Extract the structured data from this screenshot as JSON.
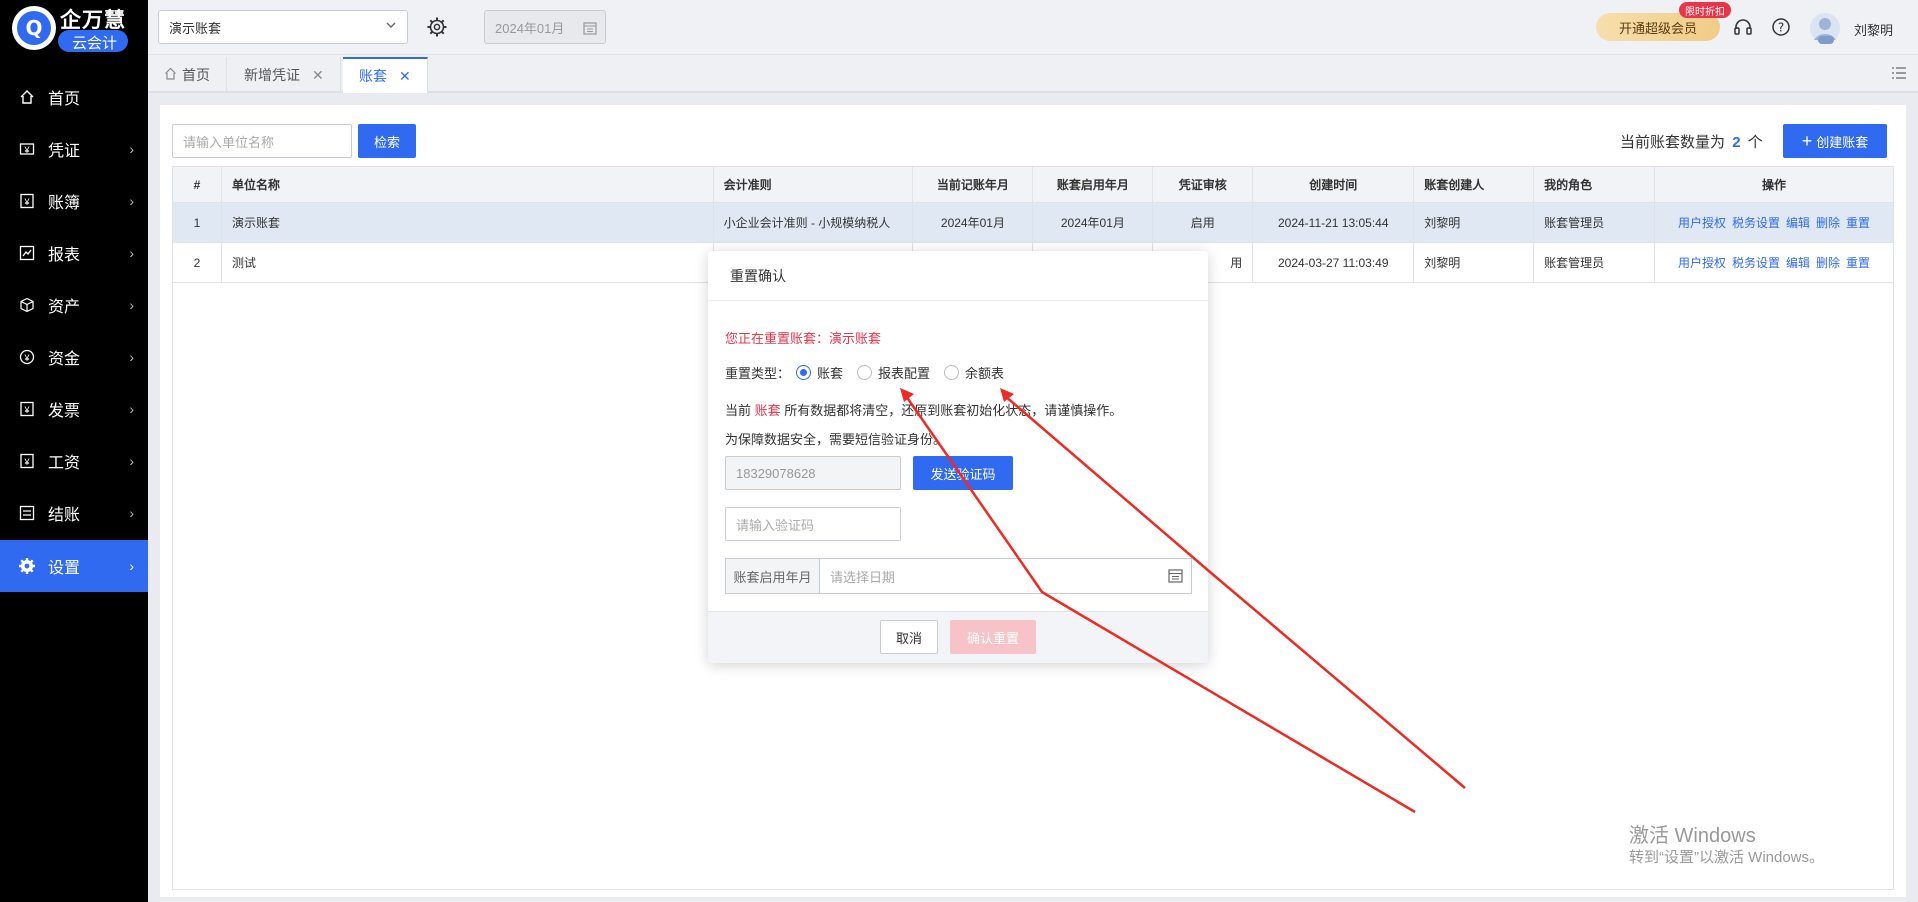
{
  "logo": {
    "brand": "企万慧",
    "sub": "云会计"
  },
  "sidebar": {
    "items": [
      {
        "label": "首页",
        "icon": "home-icon"
      },
      {
        "label": "凭证",
        "icon": "voucher-icon"
      },
      {
        "label": "账簿",
        "icon": "ledger-icon"
      },
      {
        "label": "报表",
        "icon": "chart-icon"
      },
      {
        "label": "资产",
        "icon": "cube-icon"
      },
      {
        "label": "资金",
        "icon": "yen-icon"
      },
      {
        "label": "发票",
        "icon": "invoice-icon"
      },
      {
        "label": "工资",
        "icon": "salary-icon"
      },
      {
        "label": "结账",
        "icon": "checkout-icon"
      },
      {
        "label": "设置",
        "icon": "gear-icon",
        "active": true
      }
    ]
  },
  "topbar": {
    "account_select": "演示账套",
    "period": "2024年01月",
    "vip_button": "开通超级会员",
    "vip_badge": "限时折扣",
    "user_name": "刘黎明"
  },
  "tabs": [
    {
      "label": "首页"
    },
    {
      "label": "新增凭证"
    },
    {
      "label": "账套",
      "active": true
    }
  ],
  "toolbar": {
    "search_placeholder": "请输入单位名称",
    "search_button": "检索",
    "count_prefix": "当前账套数量为",
    "count_value": "2",
    "count_suffix": "个",
    "create_button": "创建账套"
  },
  "table": {
    "columns": [
      "#",
      "单位名称",
      "会计准则",
      "当前记账年月",
      "账套启用年月",
      "凭证审核",
      "创建时间",
      "账套创建人",
      "我的角色",
      "操作"
    ],
    "rows": [
      {
        "no": "1",
        "name": "演示账套",
        "standard": "小企业会计准则 - 小规模纳税人",
        "current": "2024年01月",
        "start": "2024年01月",
        "audit": "启用",
        "created": "2024-11-21 13:05:44",
        "creator": "刘黎明",
        "role": "账套管理员"
      },
      {
        "no": "2",
        "name": "测试",
        "standard": "",
        "current": "",
        "start": "",
        "audit": "用",
        "created": "2024-03-27 11:03:49",
        "creator": "刘黎明",
        "role": "账套管理员"
      }
    ],
    "actions": [
      "用户授权",
      "税务设置",
      "编辑",
      "删除",
      "重置"
    ]
  },
  "modal": {
    "title": "重置确认",
    "notice_prefix": "您正在重置账套：",
    "notice_name": "演示账套",
    "type_label": "重置类型：",
    "options": [
      "账套",
      "报表配置",
      "余额表"
    ],
    "warn_prefix": "当前",
    "warn_type": "账套",
    "warn_suffix": "所有数据都将清空，还原到账套初始化状态，请谨慎操作。",
    "security": "为保障数据安全，需要短信验证身份。",
    "phone": "18329078628",
    "send_code": "发送验证码",
    "code_placeholder": "请输入验证码",
    "date_label": "账套启用年月",
    "date_placeholder": "请选择日期",
    "cancel": "取消",
    "confirm": "确认重置"
  },
  "watermark": {
    "line1": "激活 Windows",
    "line2": "转到“设置”以激活 Windows。"
  },
  "colors": {
    "accent": "#2f6af0",
    "danger": "#e8354a",
    "sidebar": "#000000"
  }
}
